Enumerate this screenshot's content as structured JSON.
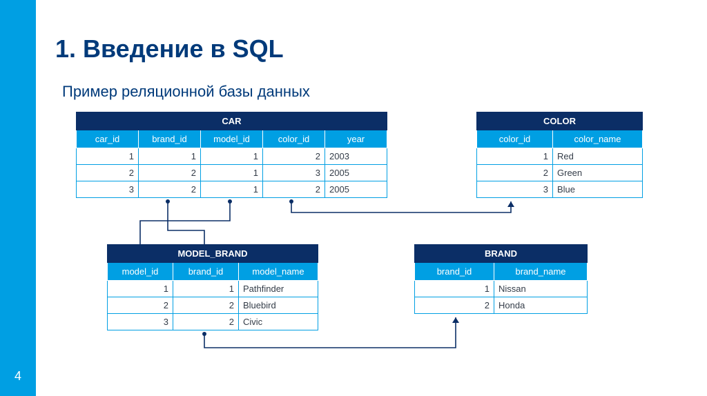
{
  "page_number": "4",
  "heading": "1. Введение в SQL",
  "subtitle": "Пример реляционной базы данных",
  "tables": {
    "car": {
      "title": "CAR",
      "columns": [
        "car_id",
        "brand_id",
        "model_id",
        "color_id",
        "year"
      ],
      "rows": [
        [
          "1",
          "1",
          "1",
          "2",
          "2003"
        ],
        [
          "2",
          "2",
          "1",
          "3",
          "2005"
        ],
        [
          "3",
          "2",
          "1",
          "2",
          "2005"
        ]
      ]
    },
    "color": {
      "title": "COLOR",
      "columns": [
        "color_id",
        "color_name"
      ],
      "rows": [
        [
          "1",
          "Red"
        ],
        [
          "2",
          "Green"
        ],
        [
          "3",
          "Blue"
        ]
      ]
    },
    "model_brand": {
      "title": "MODEL_BRAND",
      "columns": [
        "model_id",
        "brand_id",
        "model_name"
      ],
      "rows": [
        [
          "1",
          "1",
          "Pathfinder"
        ],
        [
          "2",
          "2",
          "Bluebird"
        ],
        [
          "3",
          "2",
          "Civic"
        ]
      ]
    },
    "brand": {
      "title": "BRAND",
      "columns": [
        "brand_id",
        "brand_name"
      ],
      "rows": [
        [
          "1",
          "Nissan"
        ],
        [
          "2",
          "Honda"
        ]
      ]
    }
  }
}
